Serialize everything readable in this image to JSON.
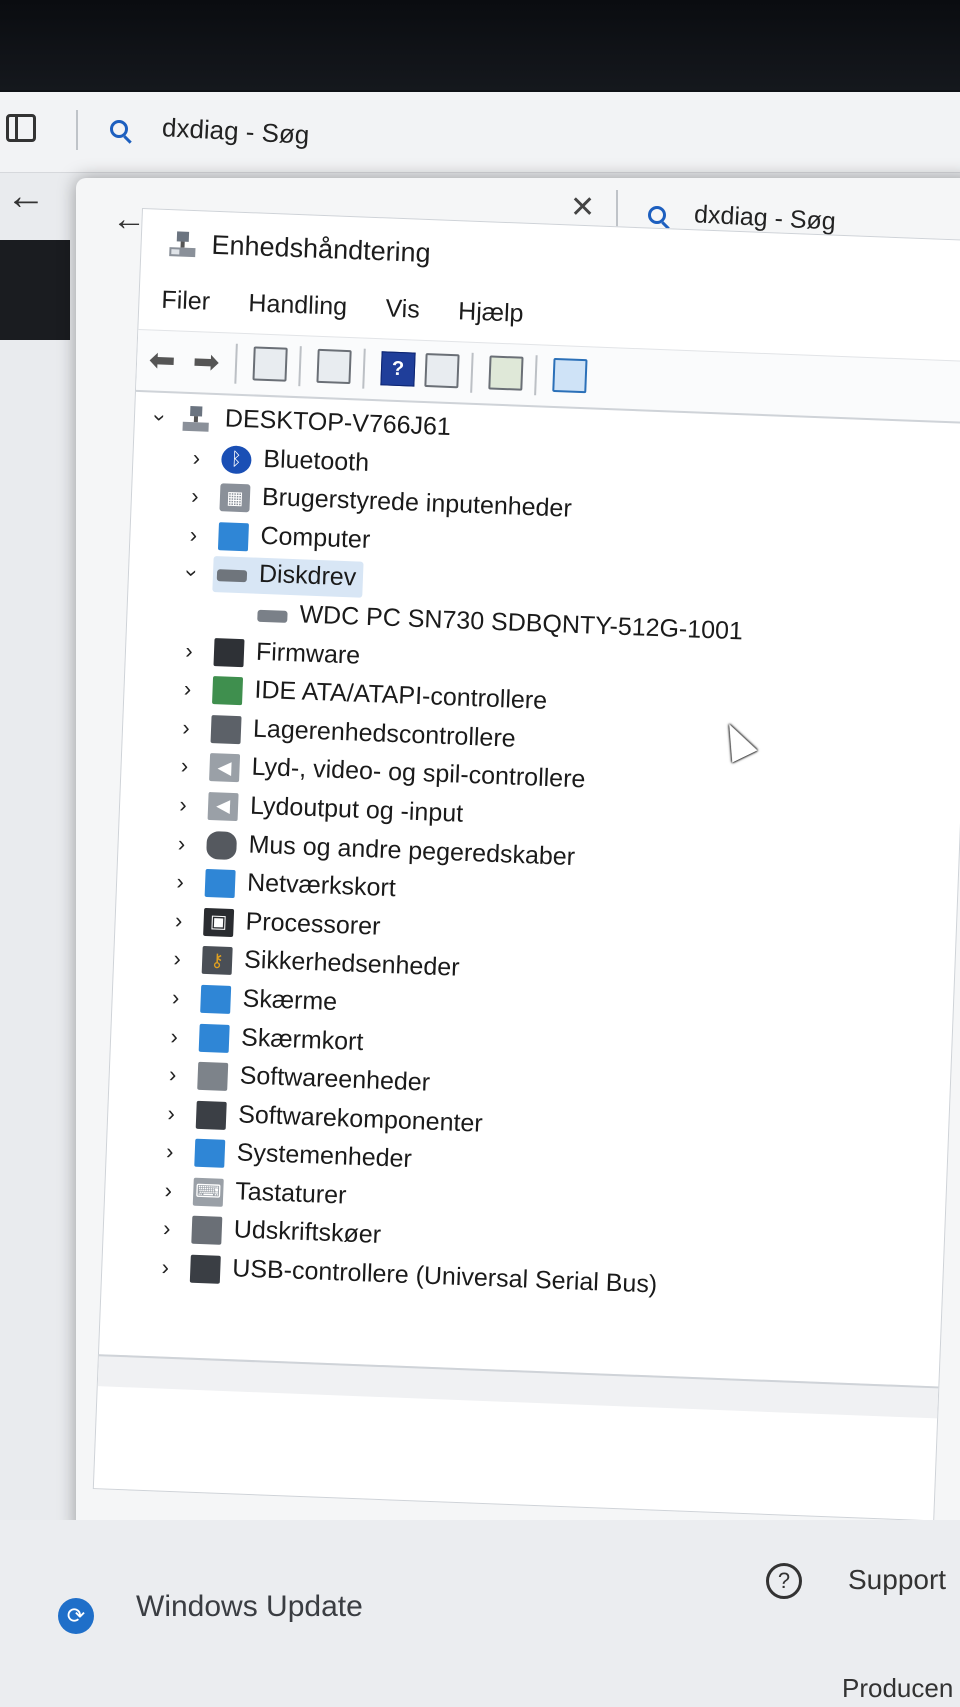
{
  "back_window": {
    "search_text": "dxdiag - Søg",
    "footer": {
      "windows_update": "Windows Update",
      "support": "Support",
      "producer": "Producen"
    }
  },
  "mid_window": {
    "search_text": "dxdiag - Søg"
  },
  "device_manager": {
    "title": "Enhedshåndtering",
    "menu": [
      "Filer",
      "Handling",
      "Vis",
      "Hjælp"
    ],
    "toolbar": {
      "help_glyph": "?"
    },
    "root": "DESKTOP-V766J61",
    "categories": [
      {
        "label": "Bluetooth",
        "icon": "bluetooth-icon"
      },
      {
        "label": "Brugerstyrede inputenheder",
        "icon": "hid-icon"
      },
      {
        "label": "Computer",
        "icon": "computer-icon"
      },
      {
        "label": "Diskdrev",
        "icon": "disk-drive-icon",
        "expanded": true
      },
      {
        "label": "WDC PC SN730 SDBQNTY-512G-1001",
        "icon": "disk-icon",
        "child": true
      },
      {
        "label": "Firmware",
        "icon": "firmware-icon"
      },
      {
        "label": "IDE ATA/ATAPI-controllere",
        "icon": "ide-controller-icon"
      },
      {
        "label": "Lagerenhedscontrollere",
        "icon": "storage-controller-icon"
      },
      {
        "label": "Lyd-, video- og spil-controllere",
        "icon": "sound-icon"
      },
      {
        "label": "Lydoutput og -input",
        "icon": "audio-io-icon"
      },
      {
        "label": "Mus og andre pegeredskaber",
        "icon": "mouse-icon"
      },
      {
        "label": "Netværkskort",
        "icon": "network-adapter-icon"
      },
      {
        "label": "Processorer",
        "icon": "processor-icon"
      },
      {
        "label": "Sikkerhedsenheder",
        "icon": "security-device-icon"
      },
      {
        "label": "Skærme",
        "icon": "monitor-icon"
      },
      {
        "label": "Skærmkort",
        "icon": "display-adapter-icon"
      },
      {
        "label": "Softwareenheder",
        "icon": "software-device-icon"
      },
      {
        "label": "Softwarekomponenter",
        "icon": "software-component-icon"
      },
      {
        "label": "Systemenheder",
        "icon": "system-device-icon"
      },
      {
        "label": "Tastaturer",
        "icon": "keyboard-icon"
      },
      {
        "label": "Udskriftskøer",
        "icon": "print-queue-icon"
      },
      {
        "label": "USB-controllere (Universal Serial Bus)",
        "icon": "usb-icon"
      }
    ]
  }
}
